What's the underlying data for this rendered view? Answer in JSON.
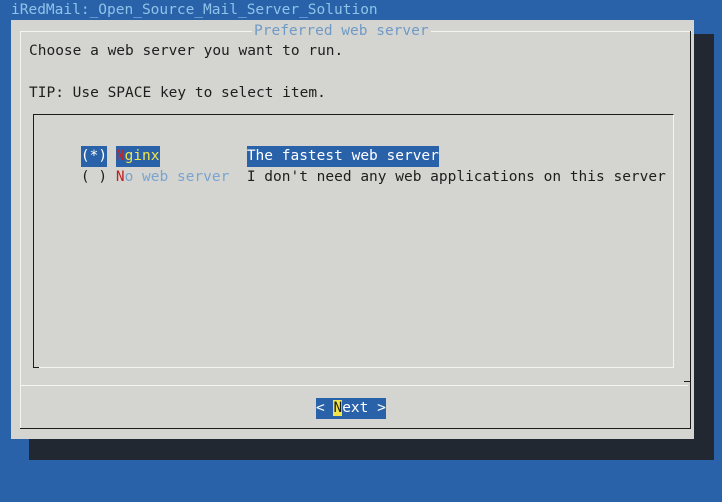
{
  "backtitle": "iRedMail:_Open_Source_Mail_Server_Solution",
  "dialog": {
    "title": "Preferred web server",
    "prompt": "Choose a web server you want to run.",
    "tip": "TIP: Use SPACE key to select item."
  },
  "items": [
    {
      "marker": "(*)",
      "hotkey": "N",
      "tag_rest": "ginx",
      "description": "The fastest web server",
      "selected": true
    },
    {
      "marker": "( )",
      "hotkey": "N",
      "tag_rest": "o web server",
      "description": "I don't need any web applications on this server",
      "selected": false
    }
  ],
  "buttons": {
    "next": {
      "left": "< ",
      "hotkey": "N",
      "rest": "ext",
      "right": " >"
    }
  },
  "colors": {
    "screen_bg": "#2a62a9",
    "dialog_bg": "#d4d5d0",
    "highlight": "#2a62a9",
    "hotkey_red": "#c51c1c",
    "hotkey_yellow": "#f2e54b",
    "tag_blue": "#7aa4cf"
  }
}
